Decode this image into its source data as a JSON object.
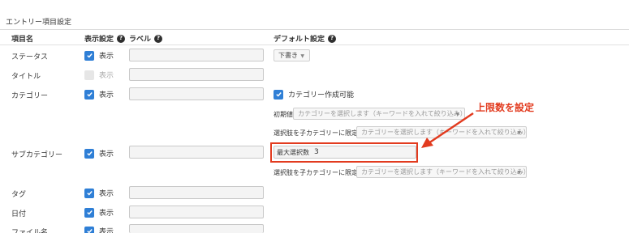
{
  "section_title": "エントリー項目設定",
  "headers": {
    "name": "項目名",
    "display": "表示設定",
    "label": "ラベル",
    "default": "デフォルト設定"
  },
  "show_text": "表示",
  "rows": [
    {
      "name": "ステータス",
      "checked": true
    },
    {
      "name": "タイトル",
      "checked": false
    },
    {
      "name": "カテゴリー",
      "checked": true
    },
    {
      "name": "サブカテゴリー",
      "checked": true
    },
    {
      "name": "タグ",
      "checked": true
    },
    {
      "name": "日付",
      "checked": true
    },
    {
      "name": "ファイル名",
      "checked": true
    }
  ],
  "status_default": "下書き",
  "category": {
    "create_label": "カテゴリー作成可能",
    "initial_label": "初期値",
    "initial_placeholder": "カテゴリーを選択します（キーワードを入れて絞り込み）",
    "limit_label": "選択肢を子カテゴリーに限定",
    "limit_placeholder": "カテゴリーを選択します（キーワードを入れて絞り込み）"
  },
  "subcategory": {
    "max_label": "最大選択数",
    "max_value": "3",
    "limit_label": "選択肢を子カテゴリーに限定",
    "limit_placeholder": "カテゴリーを選択します（キーワードを入れて絞り込み）"
  },
  "annotation": {
    "text": "上限数を設定",
    "color": "#e23b1f"
  },
  "colors": {
    "checkbox": "#2f7fd6"
  }
}
